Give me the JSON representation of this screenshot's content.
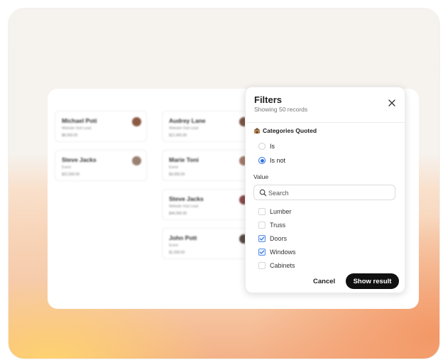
{
  "cards": [
    {
      "name": "Michael Poti",
      "sub": "Website Visit Lead",
      "amount": "$8,000.00",
      "avatar_color": "#8a5a44"
    },
    {
      "name": "Steve Jacks",
      "sub": "Event",
      "amount": "$22,500.00",
      "avatar_color": "#9a8070"
    },
    {
      "name": "Audrey Lane",
      "sub": "Website Visit Lead",
      "amount": "$12,400.00",
      "avatar_color": "#7a5545"
    },
    {
      "name": "Marie Toni",
      "sub": "Event",
      "amount": "$4,000.00",
      "avatar_color": "#a07a6a"
    },
    {
      "name": "Steve Jacks",
      "sub": "Website Visit Lead",
      "amount": "$44,000.00",
      "avatar_color": "#8a4a4a"
    },
    {
      "name": "John Pott",
      "sub": "Event",
      "amount": "$1,000.00",
      "avatar_color": "#5a4a44"
    }
  ],
  "filters": {
    "title": "Filters",
    "subtitle": "Showing 50 records",
    "close_icon": "close-icon",
    "section_icon": "categories-icon",
    "section_label": "Categories Quoted",
    "radios": [
      {
        "label": "Is",
        "selected": false
      },
      {
        "label": "Is not",
        "selected": true
      }
    ],
    "value_label": "Value",
    "search_placeholder": "Search",
    "options": [
      {
        "label": "Lumber",
        "checked": false
      },
      {
        "label": "Truss",
        "checked": false
      },
      {
        "label": "Doors",
        "checked": true
      },
      {
        "label": "Windows",
        "checked": true
      },
      {
        "label": "Cabinets",
        "checked": false
      }
    ],
    "cancel_label": "Cancel",
    "show_label": "Show result",
    "accent": "#2b6fe0"
  }
}
